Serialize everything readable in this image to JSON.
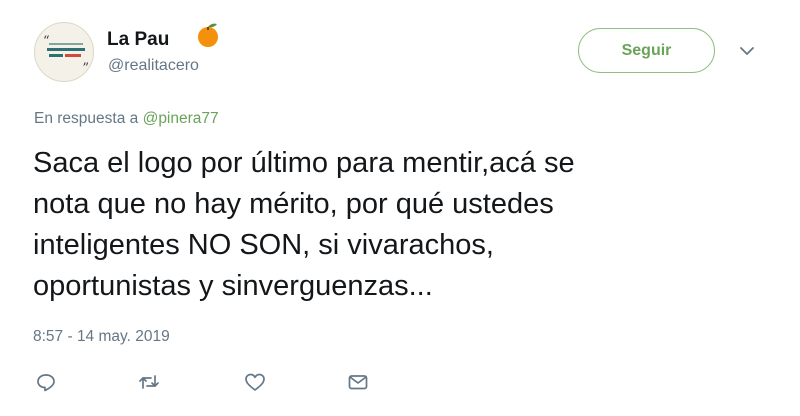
{
  "user": {
    "display_name": "La Pau",
    "handle": "@realitacero",
    "name_emoji": "orange-emoji"
  },
  "follow_button": {
    "label": "Seguir"
  },
  "reply_context": {
    "prefix": "En respuesta a",
    "mention": "@pinera77"
  },
  "tweet": {
    "text": "Saca el logo por último para mentir,acá se\nnota que no hay mérito, por qué ustedes\ninteligentes NO SON, si vivarachos,\noportunistas y sinverguenzas...",
    "timestamp": "8:57 - 14 may. 2019"
  },
  "actions": [
    "reply-icon",
    "retweet-icon",
    "like-icon",
    "direct-message-icon"
  ],
  "colors": {
    "accent_green": "#6aa35a",
    "secondary_text": "#657786",
    "primary_text": "#14171a"
  }
}
